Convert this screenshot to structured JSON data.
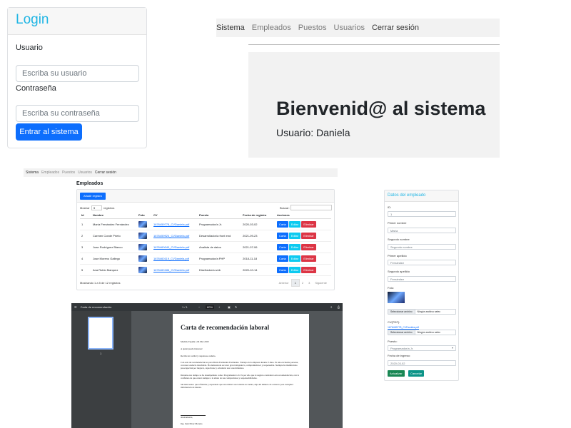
{
  "login": {
    "title": "Login",
    "user_label": "Usuario",
    "user_placeholder": "Escriba su usuario",
    "pass_label": "Contraseña",
    "pass_placeholder": "Escriba su contraseña",
    "submit": "Entrar al sistema"
  },
  "nav": {
    "brand": "Sistema",
    "items": [
      "Empleados",
      "Puestos",
      "Usuarios"
    ],
    "logout": "Cerrar sesión"
  },
  "welcome": {
    "heading": "Bienvenid@ al sistema",
    "user": "Usuario: Daniela"
  },
  "empleados": {
    "title": "Empleados",
    "add_button": "Añadir registro",
    "show_prefix": "Mostrar",
    "show_value": "5",
    "show_suffix": "registros",
    "search_label": "Buscar:",
    "columns": [
      "Id",
      "Nombre",
      "Foto",
      "CV",
      "Puesto",
      "Fecha de registro",
      "Acciones"
    ],
    "rows": [
      {
        "id": "1",
        "nombre": "María Fernández Fernández",
        "cv": "1676459778_CVDaniela.pdf",
        "puesto": "Programador/a Jr.",
        "fecha": "2020-03-02"
      },
      {
        "id": "2",
        "nombre": "Carmen Conde Prieto",
        "cv": "1676459924_CVDaniela.pdf",
        "puesto": "Desarrollador/a front end",
        "fecha": "2021-09-23"
      },
      {
        "id": "3",
        "nombre": "Juan Rodríguez Blanco",
        "cv": "1676460040_CVDaniela.pdf",
        "puesto": "Analista de datos",
        "fecha": "2021-07-06"
      },
      {
        "id": "4",
        "nombre": "Jose Moreno Gallego",
        "cv": "1676460119_CVDaniela.pdf",
        "puesto": "Programador/a PHP",
        "fecha": "2018-11-18"
      },
      {
        "id": "5",
        "nombre": "Ana Rubio Marquez",
        "cv": "1676460186_CVDaniela.pdf",
        "puesto": "Diseñador/a web",
        "fecha": "2020-10-14"
      }
    ],
    "actions": {
      "carta": "Carta",
      "editar": "Editar",
      "eliminar": "Eliminar"
    },
    "footer": "Mostrando 1 a 5 de 12 registros",
    "pager": {
      "prev": "Anterior",
      "pages": [
        "1",
        "2",
        "3"
      ],
      "next": "Siguiente"
    }
  },
  "datos": {
    "title": "Datos del empleado",
    "id_label": "ID:",
    "id_value": "1",
    "pn_label": "Primer nombre",
    "pn_value": "María",
    "sn_label": "Segundo nombre",
    "sn_value": "Segundo nombre",
    "pa_label": "Primer apellido",
    "pa_value": "Fernández",
    "sa_label": "Segundo apellido",
    "sa_value": "Fernández",
    "foto_label": "Foto:",
    "file_button": "Seleccionar archivo",
    "file_none": "Ningún archivo selec",
    "cv_label": "CV(PDF):",
    "cv_link": "1676459778_CVDaniela.pdf",
    "puesto_label": "Puesto:",
    "puesto_value": "Programador/a Jr.",
    "fecha_label": "Fecha de ingreso:",
    "fecha_value": "2020-03-02",
    "update": "Actualizar",
    "cancel": "Cancelar"
  },
  "pdf": {
    "title": "Carta de recomendación",
    "page_indicator": "1 / 1",
    "zoom": "80%",
    "thumb_number": "1",
    "doc_title": "Carta de recomendación laboral",
    "date_line": "Madrid, España a 04 Mar 2023",
    "greeting": "A quien pueda interesar:",
    "para1": "Reciba un cordial y respetuoso saludo.",
    "para2": "Con esta de recomendación es para María Fernández Fernández. Trabajó en la empresa durante 3 años. Es una excelente persona, con una conducta intachable. Ha demostrado ser un/a gran trabajador/a, comprometido/a y responsable. Siempre ha manifestado preocupación por mejorar, capacitarse y actualizar sus conocimientos.",
    "para3": "Durante este tiempo se ha desempeñado como: Programador/a Jr. Es por ello que le sugiero considerar esta recomendación, con la confianza de que estará siempre a la altura de sus compromisos y responsabilidades.",
    "para4": "Sin más nada a que referirme y esperando que esta misiva sea tomada en cuenta, dejo mi número de contacto para cualquier información de interés.",
    "closing": "Atentamente,",
    "signer": "Ing. Juan Pérez Moreno"
  },
  "colors": {
    "primary": "#0d6efd",
    "info": "#0dcaf0",
    "danger": "#dc3545",
    "success": "#198754",
    "heading_cyan": "#1fb5e4"
  }
}
